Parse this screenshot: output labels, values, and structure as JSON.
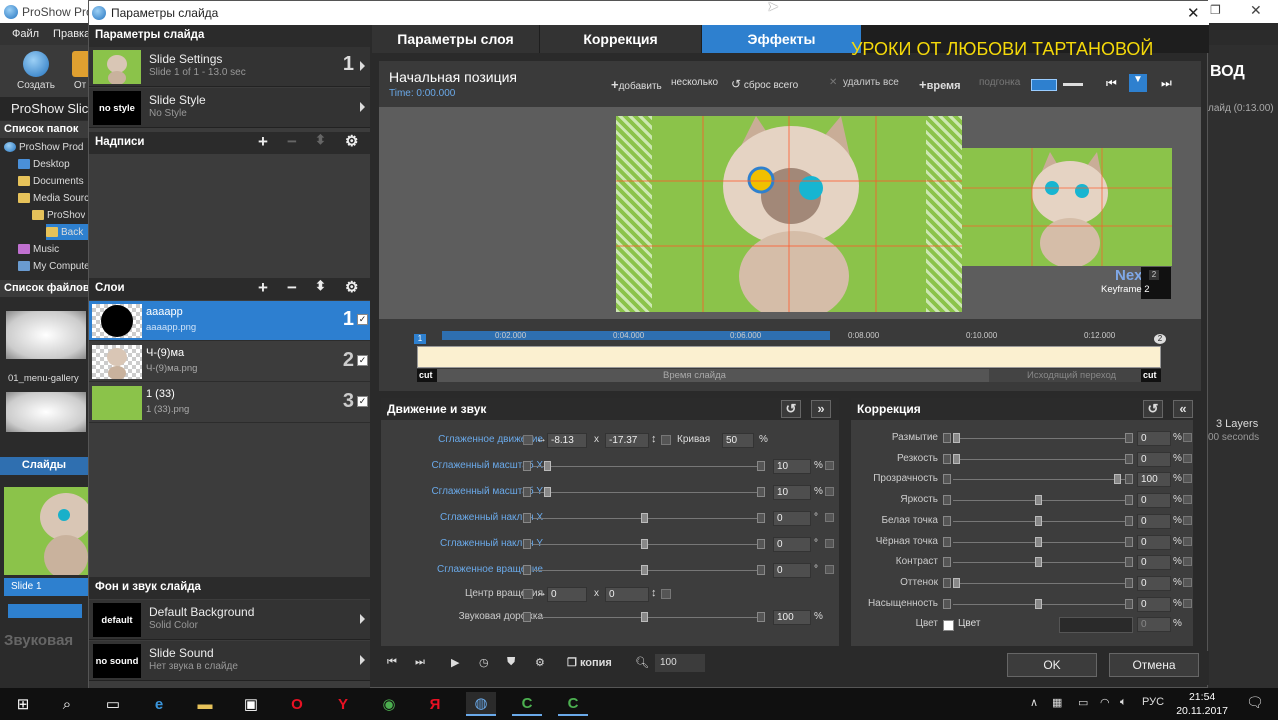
{
  "background_app": {
    "title": "ProShow Pro",
    "menu": [
      "Файл",
      "Правка"
    ],
    "toolbar": {
      "create_label": "Создать",
      "second_label": "От"
    },
    "project_title": "ProShow Slic",
    "folders_header": "Список папок",
    "tree": [
      "ProShow Prod",
      "Desktop",
      "Documents",
      "Media Sourc",
      "ProShov",
      "Back",
      "Music",
      "My Compute"
    ],
    "files_header": "Список файлов",
    "file_name": "01_menu-gallery",
    "slides_tab": "Слайды",
    "slide_caption": "Slide 1",
    "sound_label": "Звуковая",
    "right_title": "ВОД",
    "right_duration": "лайд (0:13.00)",
    "right_layers": "3 Layers",
    "right_seconds": "00 seconds"
  },
  "dialog": {
    "title": "Параметры слайда",
    "promo": "УРОКИ ОТ ЛЮБОВИ ТАРТАНОВОЙ",
    "left": {
      "header": "Параметры слайда",
      "slide_settings": {
        "title": "Slide Settings",
        "sub": "Slide 1 of 1 - 13.0 sec",
        "num": "1"
      },
      "slide_style": {
        "box": "no style",
        "title": "Slide Style",
        "sub": "No Style"
      },
      "captions_header": "Надписи",
      "layers_header": "Слои",
      "layers": [
        {
          "name": "aaaapp",
          "file": "aaaapp.png",
          "num": "1"
        },
        {
          "name": "Ч-(9)ма",
          "file": "Ч-(9)ма.png",
          "num": "2"
        },
        {
          "name": "1 (33)",
          "file": "1 (33).png",
          "num": "3"
        }
      ],
      "bg_sound_header": "Фон и звук слайда",
      "background": {
        "box": "default",
        "title": "Default Background",
        "sub": "Solid Color"
      },
      "sound": {
        "box": "no sound",
        "title": "Slide Sound",
        "sub": "Нет звука в слайде"
      }
    },
    "tabs": [
      "Параметры слоя",
      "Коррекция",
      "Эффекты"
    ],
    "effects": {
      "title": "Начальная позиция",
      "time": "Time: 0:00.000",
      "toolbar": {
        "add": "добавить",
        "several": "несколько",
        "reset_all": "сброс всего",
        "delete_all": "удалить все",
        "time": "время",
        "match": "подгонка"
      },
      "next_label": "Nex",
      "next_badge": "2",
      "keyframe_label": "Keyframe 2",
      "marker1": "1",
      "timeline_ticks": [
        "0:02.000",
        "0:04.000",
        "0:06.000",
        "0:08.000",
        "0:10.000",
        "0:12.000"
      ],
      "tick_fracs": [
        0.13,
        0.285,
        0.44,
        0.595,
        0.75,
        0.905
      ],
      "end_marker": "2",
      "cut": "cut",
      "slide_time": "Время слайда",
      "out_transition": "Исходящий переход"
    },
    "motion": {
      "header": "Движение и звук",
      "smooth_move": {
        "label": "Сглаженное движение",
        "x": "-8.13",
        "x_sep": "x",
        "y": "-17.37",
        "curve_label": "Кривая",
        "curve": "50",
        "curve_unit": "%"
      },
      "rows": [
        {
          "label": "Сглаженный масштаб X",
          "value": "10",
          "unit": "%",
          "pos": 0.05
        },
        {
          "label": "Сглаженный масштаб Y",
          "value": "10",
          "unit": "%",
          "pos": 0.05
        },
        {
          "label": "Сглаженный наклон X",
          "value": "0",
          "unit": "°",
          "pos": 0.5
        },
        {
          "label": "Сглаженный наклон Y",
          "value": "0",
          "unit": "°",
          "pos": 0.5
        },
        {
          "label": "Сглаженное вращение",
          "value": "0",
          "unit": "°",
          "pos": 0.5
        }
      ],
      "rotation_center": {
        "label": "Центр вращения",
        "x": "0",
        "x_sep": "x",
        "y": "0"
      },
      "audio_track": {
        "label": "Звуковая дорожка",
        "value": "100",
        "unit": "%",
        "pos": 0.5
      }
    },
    "correction": {
      "header": "Коррекция",
      "rows": [
        {
          "label": "Размытие",
          "value": "0",
          "pos": 0.0
        },
        {
          "label": "Резкость",
          "value": "0",
          "pos": 0.0
        },
        {
          "label": "Прозрачность",
          "value": "100",
          "pos": 0.98
        },
        {
          "label": "Яркость",
          "value": "0",
          "pos": 0.5
        },
        {
          "label": "Белая точка",
          "value": "0",
          "pos": 0.5
        },
        {
          "label": "Чёрная точка",
          "value": "0",
          "pos": 0.5
        },
        {
          "label": "Контраст",
          "value": "0",
          "pos": 0.5
        },
        {
          "label": "Оттенок",
          "value": "0",
          "pos": 0.0
        },
        {
          "label": "Насыщенность",
          "value": "0",
          "pos": 0.5
        }
      ],
      "unit": "%",
      "color_label": "Цвет",
      "color_check_label": "Цвет",
      "color_value": "0"
    },
    "bottom": {
      "copy": "копия",
      "zoom": "100"
    },
    "ok": "OK",
    "cancel": "Отмена"
  },
  "taskbar": {
    "lang": "РУС",
    "time": "21:54",
    "date": "20.11.2017"
  },
  "colors": {
    "accent": "#2e80cf",
    "promo": "#f5d90a",
    "green": "#8bc34a"
  }
}
